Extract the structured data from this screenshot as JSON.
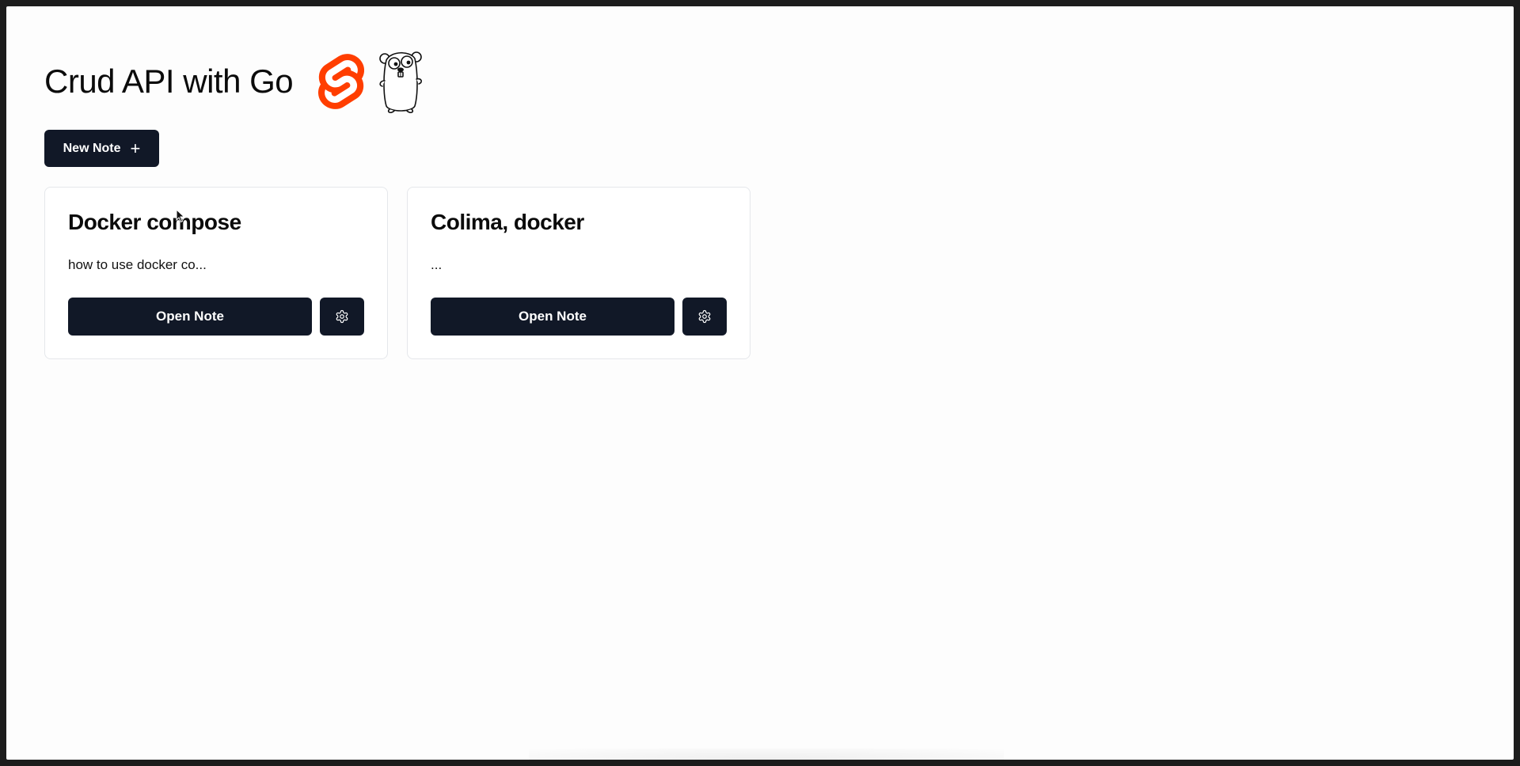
{
  "header": {
    "title": "Crud API with Go",
    "logos": [
      "svelte-logo",
      "go-gopher-logo"
    ],
    "svelte_color": "#ff3e00"
  },
  "toolbar": {
    "new_note_label": "New Note",
    "new_note_icon": "+"
  },
  "notes": [
    {
      "title": "Docker compose",
      "preview": "how to use docker co...",
      "open_label": "Open Note"
    },
    {
      "title": "Colima, docker",
      "preview": "...",
      "open_label": "Open Note"
    }
  ],
  "colors": {
    "button_bg": "#111827",
    "card_border": "#e5e7eb",
    "background": "#fdfdfd"
  }
}
